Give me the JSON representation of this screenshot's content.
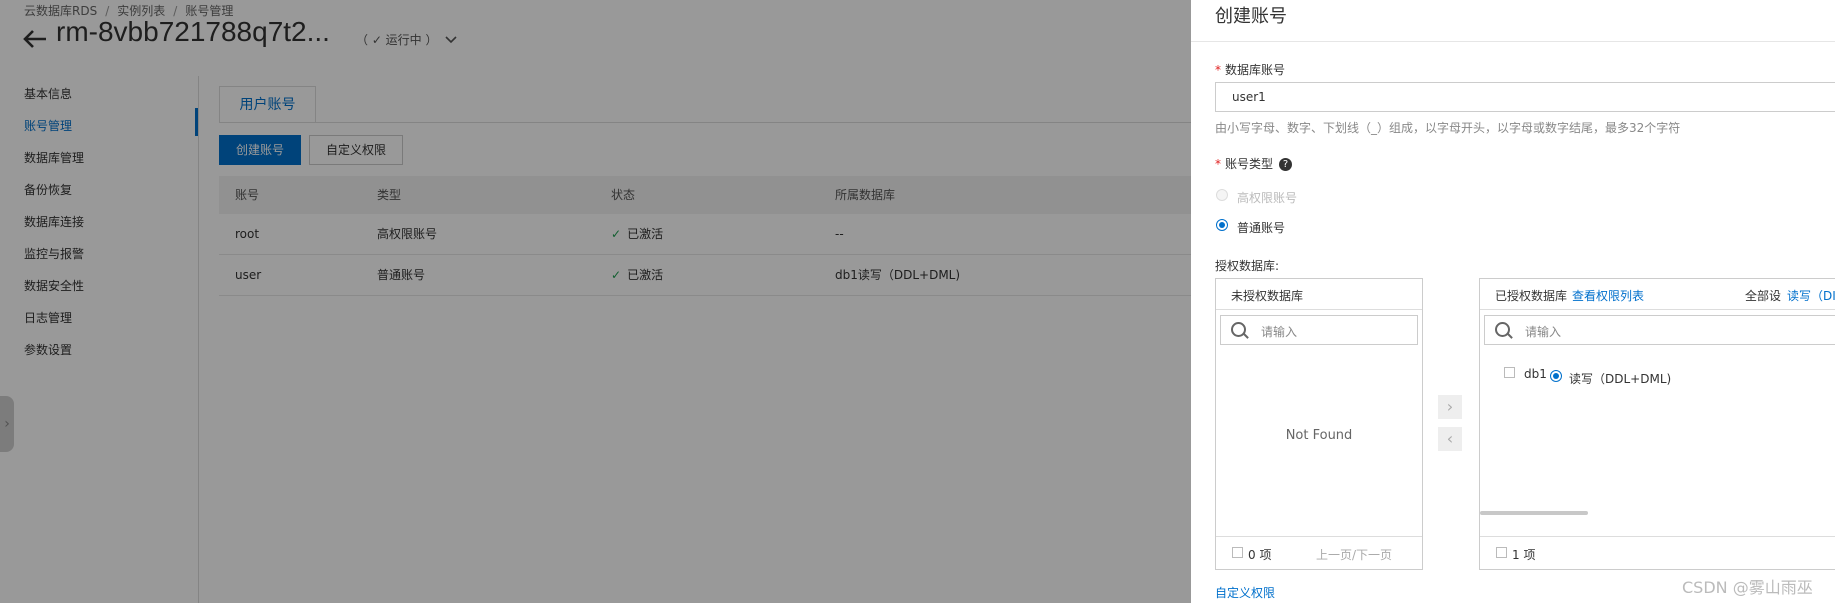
{
  "breadcrumb": [
    "云数据库RDS",
    "实例列表",
    "账号管理"
  ],
  "instance": {
    "back_icon": "arrow-left-icon",
    "title": "rm-8vbb721788q7t2...",
    "status": "（ ✓ 运行中 ）",
    "dropdown_icon": "chevron-down-icon"
  },
  "sidebar": {
    "items": [
      "基本信息",
      "账号管理",
      "数据库管理",
      "备份恢复",
      "数据库连接",
      "监控与报警",
      "数据安全性",
      "日志管理",
      "参数设置"
    ],
    "active": "账号管理"
  },
  "tab": "用户账号",
  "toolbar": {
    "create_label": "创建账号",
    "custom_label": "自定义权限"
  },
  "table": {
    "headers": [
      "账号",
      "类型",
      "状态",
      "所属数据库"
    ],
    "rows": [
      [
        "root",
        "高权限账号",
        "已激活",
        "--"
      ],
      [
        "user",
        "普通账号",
        "已激活",
        "db1读写（DDL+DML)"
      ]
    ]
  },
  "drawer": {
    "title": "创建账号",
    "db_account_label": "数据库账号",
    "db_account_value": "user1",
    "db_account_hint": "由小写字母、数字、下划线（_）组成，以字母开头，以字母或数字结尾，最多32个字符",
    "account_type_label": "账号类型",
    "help_icon": "?",
    "type_options": [
      "高权限账号",
      "普通账号"
    ],
    "selected_type": "普通账号",
    "auth_db_label": "授权数据库:",
    "left_panel": {
      "title": "未授权数据库",
      "search_placeholder": "请输入",
      "empty_text": "Not Found",
      "count": "0 项",
      "pager": "上一页/下一页"
    },
    "right_panel": {
      "title": "已授权数据库",
      "view_link": "查看权限列表",
      "set_all_label": "全部设",
      "set_all_link": "读写（DI",
      "search_placeholder": "请输入",
      "item_name": "db1",
      "item_perm": "读写（DDL+DML)",
      "count": "1 项"
    },
    "transfer_right_icon": "›",
    "transfer_left_icon": "‹",
    "custom_perm_link": "自定义权限"
  },
  "watermark": "CSDN @雾山雨巫",
  "colors": {
    "accent": "#0070cc",
    "success": "#1e9e50",
    "required": "#e02020"
  }
}
